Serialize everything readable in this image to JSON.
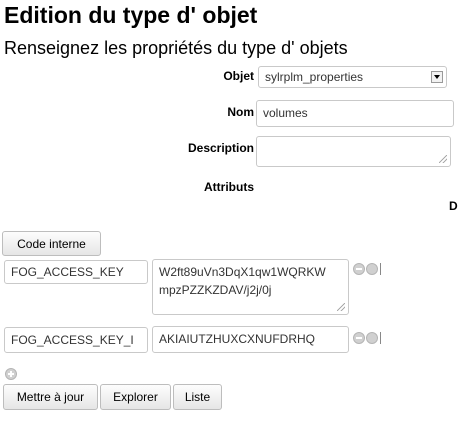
{
  "page": {
    "title": "Edition du type d' objet",
    "subtitle": "Renseignez les propriétés du type d' objets"
  },
  "form": {
    "objet_label": "Objet",
    "objet_value": "sylrplm_properties",
    "nom_label": "Nom",
    "nom_value": "volumes",
    "description_label": "Description",
    "description_value": "",
    "attributs_label": "Attributs",
    "truncated_column_label": "D"
  },
  "code_interne_button": "Code interne",
  "attributes": [
    {
      "key": "FOG_ACCESS_KEY",
      "value_line1": "W2ft89uVn3DqX1qw1WQRKW",
      "value_line2": "mpzPZZKZDAV/j2j/0j"
    },
    {
      "key": "FOG_ACCESS_KEY_I",
      "value": "AKIAIUTZHUXCXNUFDRHQ"
    }
  ],
  "actions": {
    "update": "Mettre à jour",
    "explore": "Explorer",
    "list": "Liste"
  }
}
